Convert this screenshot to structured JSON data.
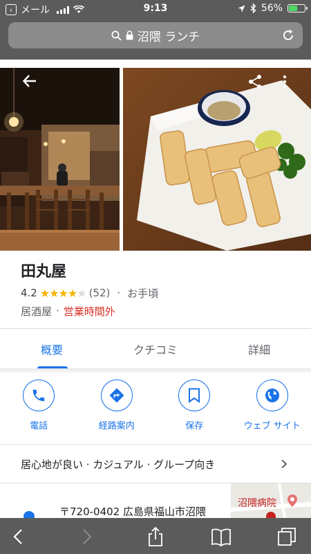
{
  "status_bar": {
    "back_app_label": "メール",
    "time": "9:13",
    "battery": "56%",
    "battery_level": 0.56
  },
  "url_bar": {
    "query": "沼隈 ランチ"
  },
  "place": {
    "name": "田丸屋",
    "rating": "4.2",
    "rating_value": 4.2,
    "review_count": "(52)",
    "price": "お手頃",
    "category": "居酒屋",
    "hours_status": "営業時間外"
  },
  "tabs": [
    {
      "label": "概要",
      "active": true
    },
    {
      "label": "クチコミ",
      "active": false
    },
    {
      "label": "詳細",
      "active": false
    }
  ],
  "actions": [
    {
      "label": "電話",
      "icon": "phone-icon"
    },
    {
      "label": "経路案内",
      "icon": "directions-icon"
    },
    {
      "label": "保存",
      "icon": "bookmark-icon"
    },
    {
      "label": "ウェブ サイト",
      "icon": "globe-icon"
    }
  ],
  "attributes": "居心地が良い · カジュアル · グループ向き",
  "address": "〒720-0402 広島県福山市沼隈",
  "map_thumbnail": {
    "label": "沼隈病院"
  },
  "colors": {
    "accent": "#1a73e8",
    "star": "#f4b400",
    "closed": "#d93025",
    "chrome": "#5b5b5b"
  }
}
